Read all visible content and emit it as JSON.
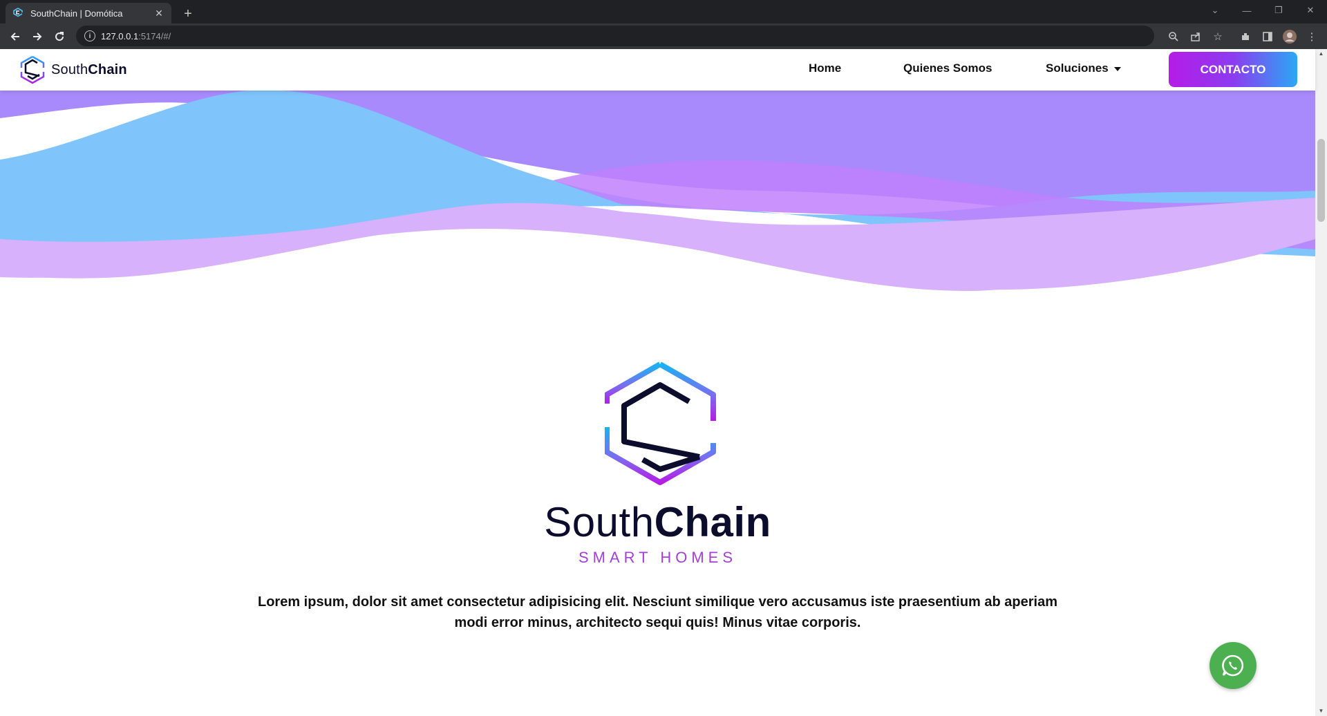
{
  "browser": {
    "tab_title": "SouthChain | Domótica",
    "tab_close": "✕",
    "new_tab": "+",
    "url_host": "127.0.0.1",
    "url_path": ":5174/#/",
    "info_icon": "i"
  },
  "nav": {
    "brand_light": "South",
    "brand_bold": "Chain",
    "links": [
      "Home",
      "Quienes Somos",
      "Soluciones"
    ],
    "cta": "CONTACTO"
  },
  "hero": {
    "brand_light": "South",
    "brand_bold": "Chain",
    "tagline": "SMART HOMES",
    "description": "Lorem ipsum, dolor sit amet consectetur adipisicing elit. Nesciunt similique vero accusamus iste praesentium ab aperiam modi error minus, architecto sequi quis! Minus vitae corporis."
  },
  "colors": {
    "accent_purple": "#b51ce6",
    "accent_blue": "#2aa8f5",
    "wave_blue": "#80c4fc",
    "wave_purple": "#a98afc",
    "wave_lavender": "#d7b1fb",
    "whatsapp_green": "#4caf50",
    "brand_dark": "#0c0c2c"
  },
  "icons": {
    "whatsapp": "whatsapp-icon",
    "logo": "southchain-hex-logo"
  }
}
